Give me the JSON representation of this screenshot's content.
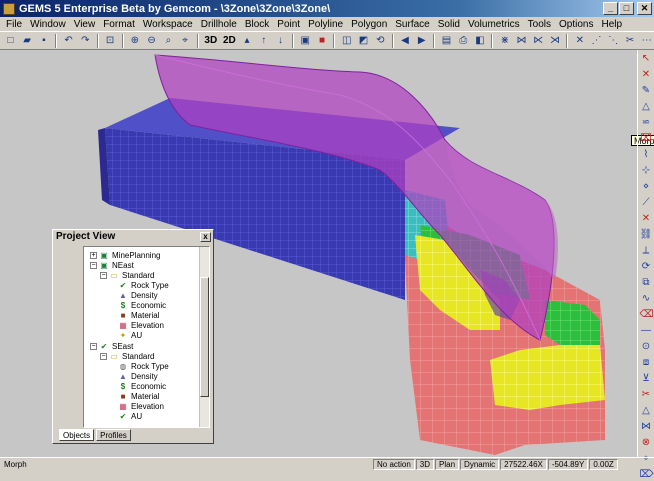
{
  "window": {
    "title": "GEMS 5 Enterprise Beta by Gemcom - \\3Zone\\3Zone\\3Zone\\",
    "minimize": "_",
    "maximize": "□",
    "close": "✕"
  },
  "menu": [
    "File",
    "Window",
    "View",
    "Format",
    "Workspace",
    "Drillhole",
    "Block",
    "Point",
    "Polyline",
    "Polygon",
    "Surface",
    "Solid",
    "Volumetrics",
    "Tools",
    "Options",
    "Help"
  ],
  "toolbar": {
    "btn_3d": "3D",
    "btn_2d": "2D"
  },
  "tooltip": "Morph",
  "project_view": {
    "title": "Project View",
    "close": "x",
    "tree": [
      {
        "label": "MinePlanning",
        "icon": "folder-icon",
        "level": 0,
        "expander": "+"
      },
      {
        "label": "NEast",
        "icon": "folder-icon",
        "level": 0,
        "expander": "−"
      },
      {
        "label": "Standard",
        "icon": "folder-open-icon",
        "level": 1,
        "expander": "−"
      },
      {
        "label": "Rock Type",
        "icon": "checked-rock-icon",
        "level": 2
      },
      {
        "label": "Density",
        "icon": "density-icon",
        "level": 2
      },
      {
        "label": "Economic",
        "icon": "dollar-icon",
        "level": 2
      },
      {
        "label": "Material",
        "icon": "material-icon",
        "level": 2
      },
      {
        "label": "Elevation",
        "icon": "elevation-icon",
        "level": 2
      },
      {
        "label": "AU",
        "icon": "au-icon",
        "level": 2
      },
      {
        "label": "SEast",
        "icon": "checked-folder-icon",
        "level": 0,
        "expander": "−"
      },
      {
        "label": "Standard",
        "icon": "folder-open-icon",
        "level": 1,
        "expander": "−"
      },
      {
        "label": "Rock Type",
        "icon": "rock-icon",
        "level": 2
      },
      {
        "label": "Density",
        "icon": "density-icon",
        "level": 2
      },
      {
        "label": "Economic",
        "icon": "dollar-icon",
        "level": 2
      },
      {
        "label": "Material",
        "icon": "material-icon",
        "level": 2
      },
      {
        "label": "Elevation",
        "icon": "elevation-icon",
        "level": 2
      },
      {
        "label": "AU",
        "icon": "checked-au-icon",
        "level": 2
      }
    ],
    "tabs": [
      "Objects",
      "Profiles"
    ]
  },
  "status": {
    "message": "Morph",
    "action": "No action",
    "mode_3d": "3D",
    "plan": "Plan",
    "dynamic": "Dynamic",
    "x": "27522.46X",
    "y": "-504.89Y",
    "z": "0.00Z"
  },
  "colors": {
    "block_blue": "#3a3ab0",
    "surface_magenta": "#b040c0",
    "block_red": "#e07070",
    "block_yellow": "#e8e820",
    "block_green": "#30c040",
    "block_cyan": "#40c0c0",
    "viewport_bg": "#c6c6c6"
  }
}
